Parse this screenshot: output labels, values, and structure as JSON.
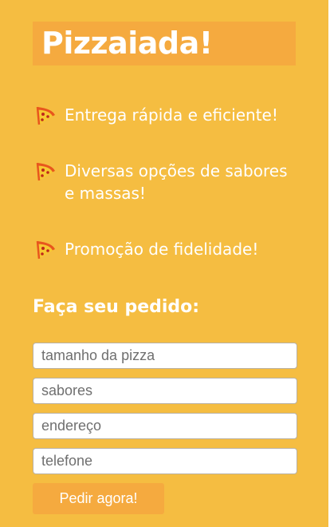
{
  "brand": {
    "title": "Pizzaiada!"
  },
  "features": [
    {
      "icon": "pizza-slice-icon",
      "text": "Entrega rápida e eficiente!"
    },
    {
      "icon": "pizza-slice-icon",
      "text": "Diversas opções de sabores e massas!"
    },
    {
      "icon": "pizza-slice-icon",
      "text": "Promoção de fidelidade!"
    }
  ],
  "order": {
    "title": "Faça seu pedido:",
    "fields": [
      {
        "placeholder": "tamanho da pizza"
      },
      {
        "placeholder": "sabores"
      },
      {
        "placeholder": "endereço"
      },
      {
        "placeholder": "telefone"
      }
    ],
    "submit_label": "Pedir agora!"
  },
  "colors": {
    "background": "#f5bd41",
    "accent": "#f5aa3f",
    "text": "#ffffff"
  }
}
